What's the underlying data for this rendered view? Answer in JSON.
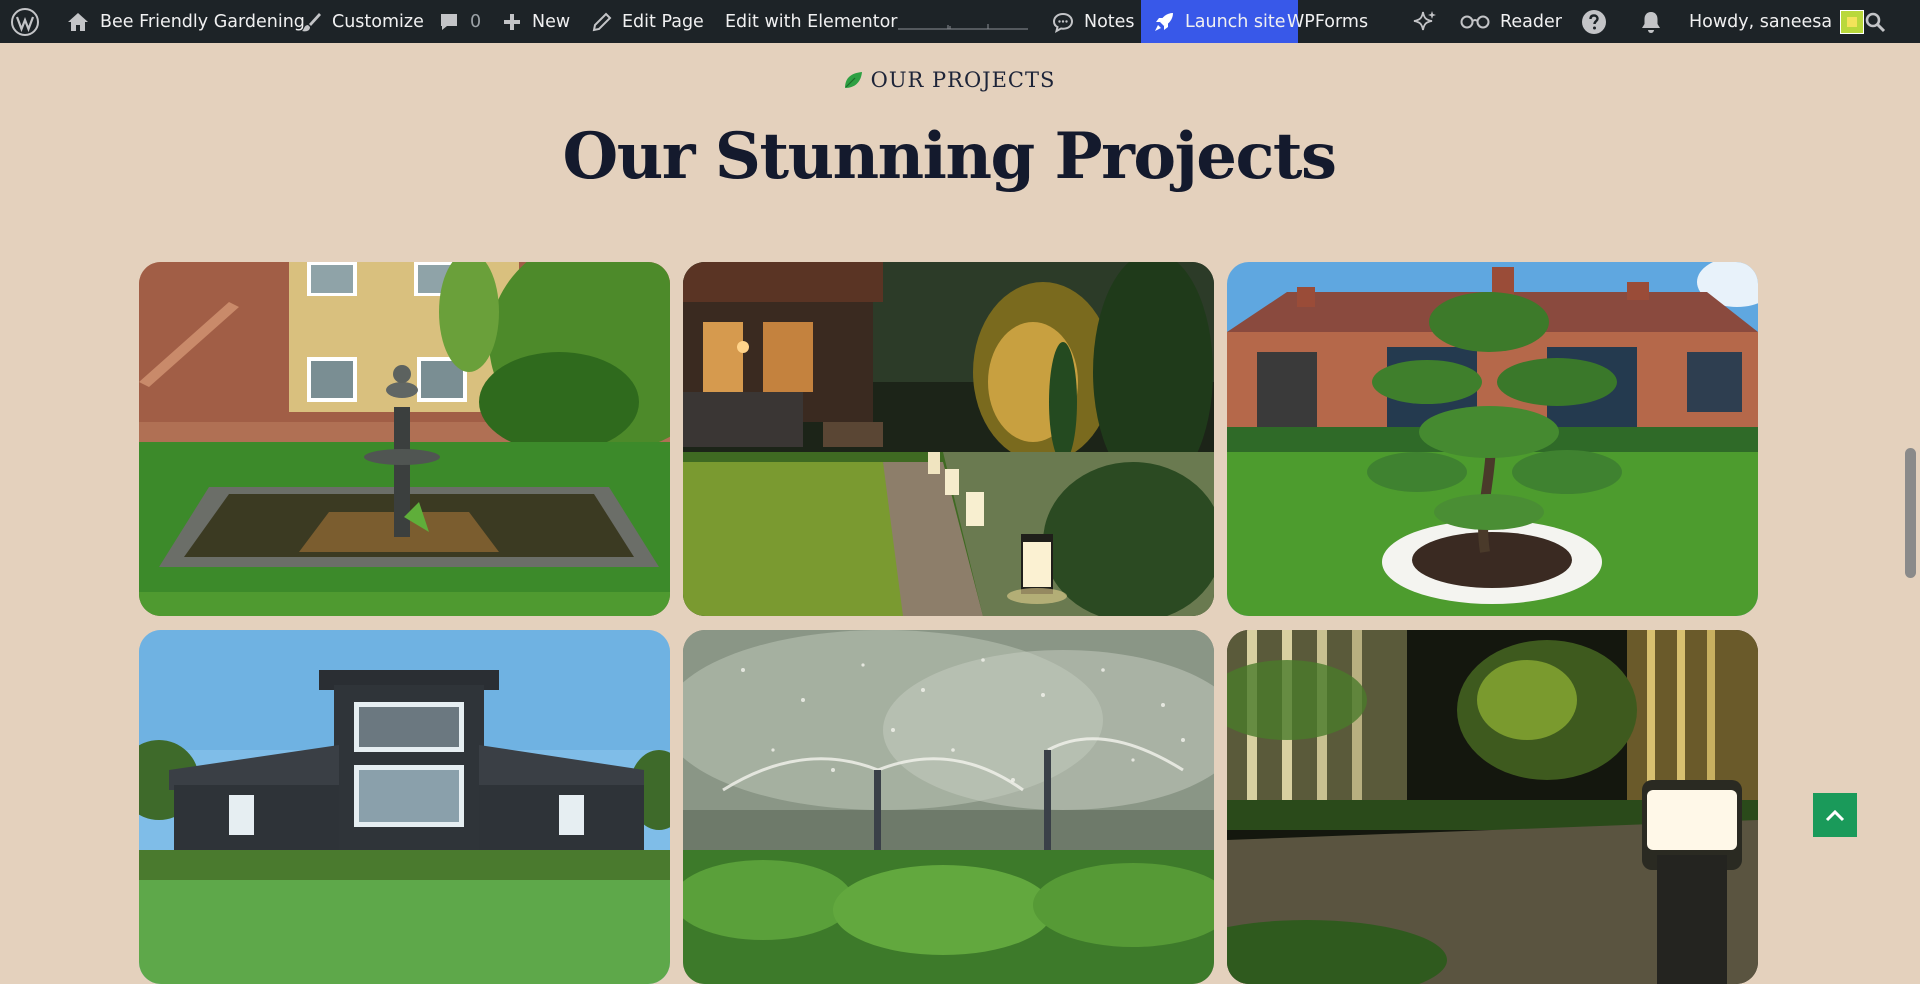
{
  "adminbar": {
    "site_name": "Bee Friendly Gardening",
    "customize": "Customize",
    "comments_count": "0",
    "new_label": "New",
    "edit_page": "Edit Page",
    "edit_elementor": "Edit with Elementor",
    "notes": "Notes",
    "launch_site": "Launch site",
    "wpforms": "WPForms",
    "reader": "Reader",
    "howdy": "Howdy, saneesa",
    "launch_color": "#3858e9"
  },
  "section": {
    "eyebrow": "OUR PROJECTS",
    "title": "Our Stunning Projects"
  },
  "projects": [
    {
      "name": "garden-fountain-pond"
    },
    {
      "name": "evening-patio-path-lights"
    },
    {
      "name": "bonsai-pine-lawn"
    },
    {
      "name": "modern-dark-house-lawn"
    },
    {
      "name": "garden-sprinklers"
    },
    {
      "name": "night-walkway-lighting"
    }
  ],
  "colors": {
    "page_bg": "#e4d1bd",
    "heading": "#141a2d",
    "accent_green": "#1a9a5a"
  }
}
